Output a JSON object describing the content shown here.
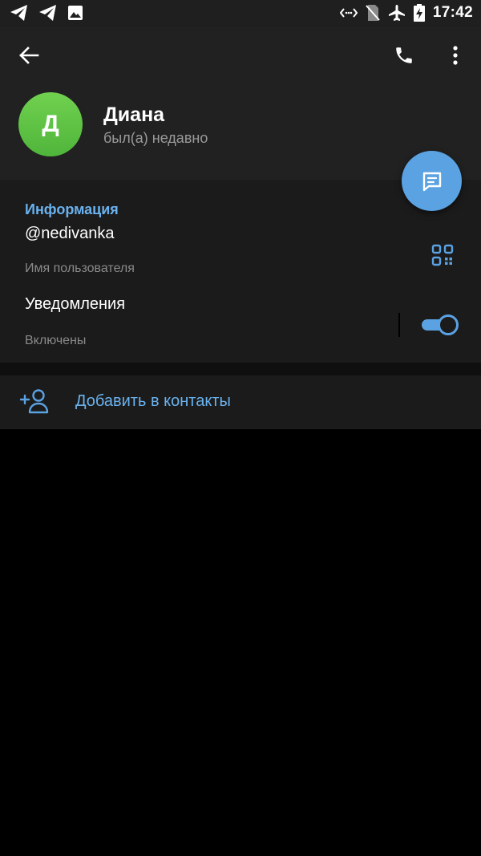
{
  "status_bar": {
    "time": "17:42",
    "left_icons": [
      "telegram-icon",
      "telegram-icon",
      "image-icon"
    ],
    "right_icons": [
      "data-saver-icon",
      "no-sim-icon",
      "airplane-icon",
      "battery-charging-icon"
    ]
  },
  "profile": {
    "avatar_letter": "Д",
    "name": "Диана",
    "status": "был(а) недавно",
    "avatar_color": "#5cc043"
  },
  "info": {
    "section_title": "Информация",
    "username": "@nedivanka",
    "username_hint": "Имя пользователя",
    "notifications_label": "Уведомления",
    "notifications_state": "Включены",
    "notifications_on": true
  },
  "actions": {
    "add_contact": "Добавить в контакты"
  },
  "colors": {
    "accent": "#5aa2e2",
    "header_bg": "#212121",
    "section_bg": "#1b1b1b",
    "link_text": "#6ab2ef"
  }
}
